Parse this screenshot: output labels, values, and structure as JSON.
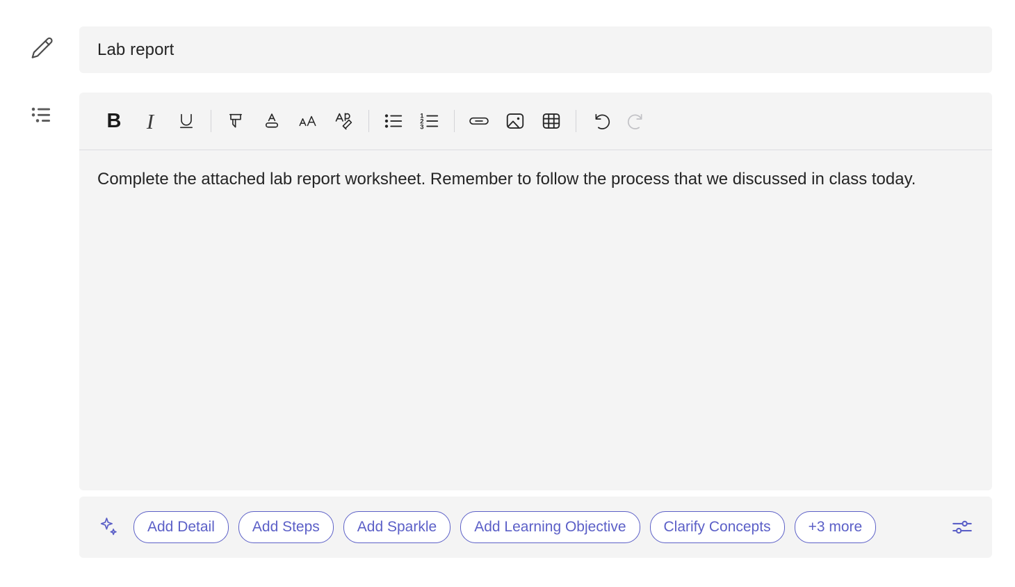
{
  "rail": {
    "pencil_icon": "pencil-icon",
    "list_icon": "instructions-list-icon"
  },
  "title_field": {
    "value": "Lab report",
    "placeholder": "Title"
  },
  "toolbar": {
    "items": [
      {
        "name": "bold-button",
        "label": "B",
        "type": "glyph-bold",
        "disabled": false
      },
      {
        "name": "italic-button",
        "label": "I",
        "type": "glyph-italic",
        "disabled": false
      },
      {
        "name": "underline-button",
        "label": "U",
        "type": "underline",
        "disabled": false
      },
      {
        "name": "separator-1",
        "label": "",
        "type": "separator",
        "disabled": false
      },
      {
        "name": "highlight-button",
        "label": "",
        "type": "highlight",
        "disabled": false
      },
      {
        "name": "font-color-button",
        "label": "",
        "type": "font-color",
        "disabled": false
      },
      {
        "name": "font-size-button",
        "label": "",
        "type": "font-size",
        "disabled": false
      },
      {
        "name": "clear-formatting-button",
        "label": "",
        "type": "clear-format",
        "disabled": false
      },
      {
        "name": "separator-2",
        "label": "",
        "type": "separator",
        "disabled": false
      },
      {
        "name": "bulleted-list-button",
        "label": "",
        "type": "bullet-list",
        "disabled": false
      },
      {
        "name": "numbered-list-button",
        "label": "",
        "type": "number-list",
        "disabled": false
      },
      {
        "name": "separator-3",
        "label": "",
        "type": "separator",
        "disabled": false
      },
      {
        "name": "insert-link-button",
        "label": "",
        "type": "link",
        "disabled": false
      },
      {
        "name": "insert-image-button",
        "label": "",
        "type": "image",
        "disabled": false
      },
      {
        "name": "insert-table-button",
        "label": "",
        "type": "table",
        "disabled": false
      },
      {
        "name": "separator-4",
        "label": "",
        "type": "separator",
        "disabled": false
      },
      {
        "name": "undo-button",
        "label": "",
        "type": "undo",
        "disabled": false
      },
      {
        "name": "redo-button",
        "label": "",
        "type": "redo",
        "disabled": true
      }
    ]
  },
  "editor": {
    "body_text": "Complete the attached lab report worksheet. Remember to follow the process that we discussed in class today."
  },
  "suggestions": {
    "sparkle_icon": "sparkle-icon",
    "settings_icon": "settings-sliders-icon",
    "chips": [
      "Add Detail",
      "Add Steps",
      "Add Sparkle",
      "Add Learning Objective",
      "Clarify Concepts",
      "+3 more"
    ]
  },
  "colors": {
    "accent": "#5b5fc7",
    "panel_bg": "#f4f4f4",
    "text": "#242424",
    "icon": "#262626",
    "icon_disabled": "#c2c2c6",
    "divider": "#dcdce0"
  }
}
